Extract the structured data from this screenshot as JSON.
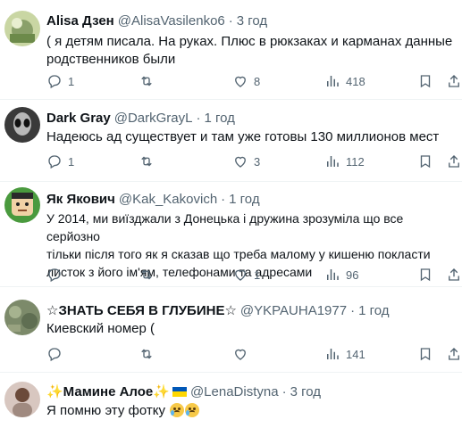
{
  "tweets": [
    {
      "name": "Alisa Дзен",
      "handle": "@AlisaVasilenko6",
      "time": "3 год",
      "lines": [
        "( я детям писала. На руках. Плюс в рюкзаках и карманах данные",
        "родственников были"
      ],
      "replies": "1",
      "retweets": "",
      "likes": "8",
      "views": "418"
    },
    {
      "name": "Dark Gray",
      "handle": "@DarkGrayL",
      "time": "1 год",
      "lines": [
        "Надеюсь ад существует и там уже готовы 130 миллионов мест"
      ],
      "replies": "1",
      "retweets": "",
      "likes": "3",
      "views": "112"
    },
    {
      "name": "Як Якович",
      "handle": "@Kak_Kakovich",
      "time": "1 год",
      "lines": [
        "У 2014, ми виїзджали з Донецька і дружина зрозуміла що все серйозно",
        "тільки після того як я сказав що треба малому у кишеню покласти",
        "листок з його ім'ям, телефонами та адресами"
      ],
      "replies": "",
      "retweets": "",
      "likes": "1",
      "views": "96"
    },
    {
      "name": "☆ЗНАТЬ СЕБЯ В ГЛУБИНЕ☆",
      "handle": "@YKPAUHA1977",
      "time": "1 год",
      "lines": [
        "Киевский номер ("
      ],
      "replies": "",
      "retweets": "",
      "likes": "",
      "views": "141"
    },
    {
      "name": "✨Мамине Алое✨",
      "handle": "@LenaDistyna",
      "time": "3 год",
      "lines": [
        "Я помню эту фотку"
      ],
      "replies": "",
      "retweets": "",
      "likes": "",
      "views": ""
    }
  ],
  "icons": [
    "reply-icon",
    "retweet-icon",
    "like-icon",
    "views-icon",
    "bookmark-icon",
    "share-icon"
  ],
  "colors": {
    "text": "#0f1419",
    "secondary": "#536471",
    "divider": "#eff3f4"
  }
}
